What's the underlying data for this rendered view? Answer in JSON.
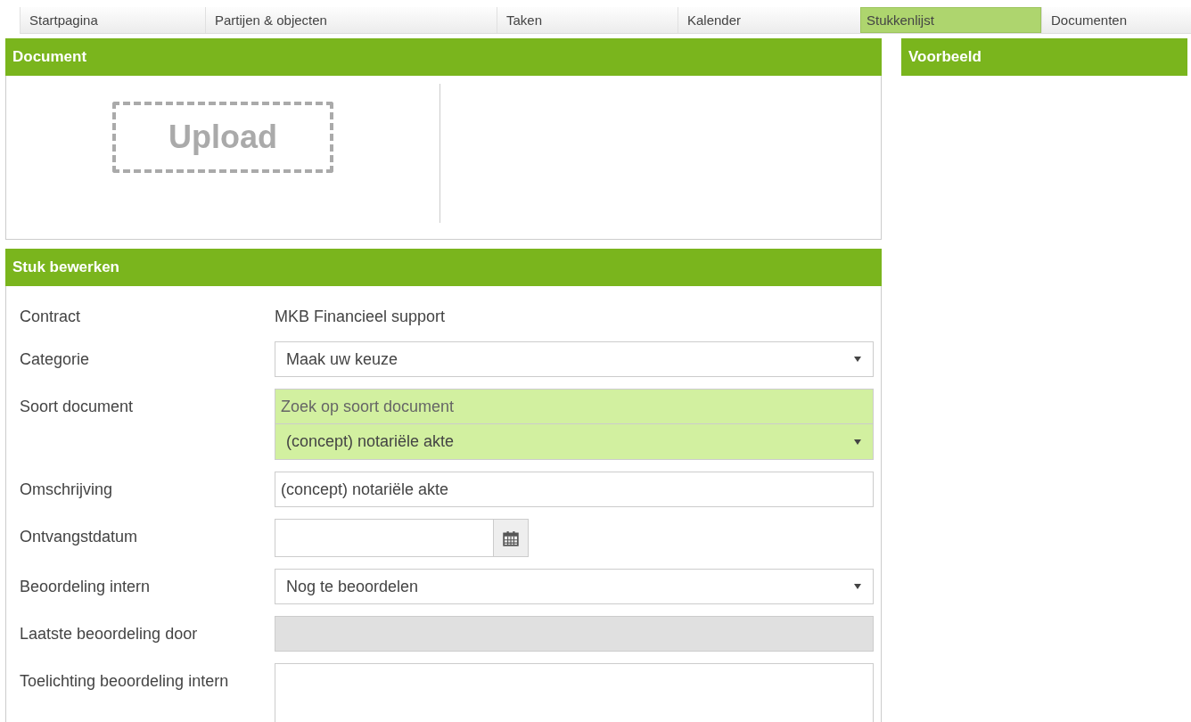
{
  "tabs": [
    {
      "label": "Startpagina",
      "selected": false
    },
    {
      "label": "Partijen & objecten",
      "selected": false
    },
    {
      "label": "Taken",
      "selected": false
    },
    {
      "label": "Kalender",
      "selected": false
    },
    {
      "label": "Stukkenlijst",
      "selected": true
    },
    {
      "label": "Documenten",
      "selected": false
    }
  ],
  "document_panel": {
    "title": "Document",
    "upload_button": "Upload"
  },
  "preview_panel": {
    "title": "Voorbeeld"
  },
  "edit_panel": {
    "title": "Stuk bewerken",
    "fields": [
      {
        "kind": "static",
        "label": "Contract",
        "value": "MKB Financieel support"
      },
      {
        "kind": "select",
        "label": "Categorie",
        "value": "Maak uw keuze",
        "highlighted": false
      },
      {
        "kind": "search-select",
        "label": "Soort document",
        "placeholder": "Zoek op soort document",
        "value": "(concept) notariële akte",
        "highlighted": true
      },
      {
        "kind": "input",
        "label": "Omschrijving",
        "value": "(concept) notariële akte",
        "highlighted": false
      },
      {
        "kind": "date",
        "label": "Ontvangstdatum"
      },
      {
        "kind": "select",
        "label": "Beoordeling intern",
        "value": "Nog te beoordelen",
        "highlighted": false
      },
      {
        "kind": "input",
        "label": "Laatste beoordeling door",
        "disabled": true,
        "highlighted": false
      },
      {
        "kind": "textarea",
        "label": "Toelichting beoordeling intern"
      }
    ]
  }
}
